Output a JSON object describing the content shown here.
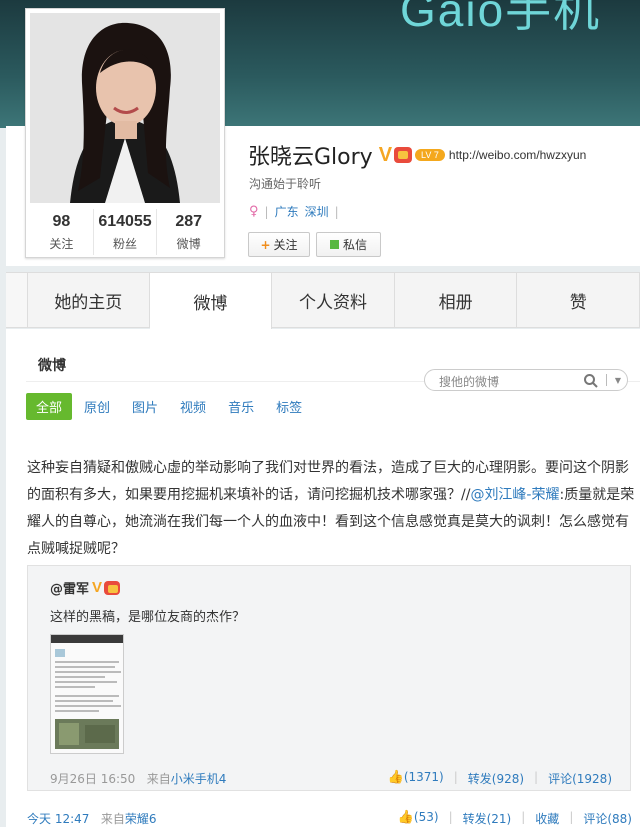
{
  "banner": {
    "logo_text": "Gaio手机"
  },
  "profile": {
    "name": "张晓云Glory",
    "verified_badge": "V",
    "level_badge": "LV 7",
    "url": "http://weibo.com/hwzxyun",
    "bio": "沟通始于聆听",
    "location_province": "广东",
    "location_city": "深圳",
    "stats": [
      {
        "value": "98",
        "label": "关注"
      },
      {
        "value": "614055",
        "label": "粉丝"
      },
      {
        "value": "287",
        "label": "微博"
      }
    ],
    "follow_button": "关注",
    "message_button": "私信"
  },
  "tabs": [
    "她的主页",
    "微博",
    "个人资料",
    "相册",
    "赞"
  ],
  "active_tab": "微博",
  "feed": {
    "section_title": "微博",
    "search_placeholder": "搜他的微博",
    "filters": [
      "全部",
      "原创",
      "图片",
      "视频",
      "音乐",
      "标签"
    ],
    "active_filter": "全部"
  },
  "post": {
    "text_main": "这种妄自猜疑和傲贼心虚的举动影响了我们对世界的看法，造成了巨大的心理阴影。要问这个阴影的面积有多大，如果要用挖掘机来填补的话，请问挖掘机技术哪家强？//",
    "mention": "@刘江峰-荣耀",
    "text_rest": ":质量就是荣耀人的自尊心，她流淌在我们每一个人的血液中！看到这个信息感觉真是莫大的讽刺！怎么感觉有点贼喊捉贼呢？",
    "time": "今天 12:47",
    "source_prefix": "来自",
    "source": "荣耀6",
    "likes": "(53)",
    "repost": "转发(21)",
    "favorite": "收藏",
    "comment": "评论(88)"
  },
  "repost": {
    "author": "@雷军",
    "verified_badge": "V",
    "text": "这样的黑稿，是哪位友商的杰作？",
    "time": "9月26日 16:50",
    "source_prefix": "来自",
    "source": "小米手机4",
    "likes": "(1371)",
    "repost": "转发(928)",
    "comment": "评论(1928)"
  },
  "colors": {
    "link": "#2f7bbd",
    "accent_green": "#66b92e",
    "verified": "#f5a623"
  }
}
